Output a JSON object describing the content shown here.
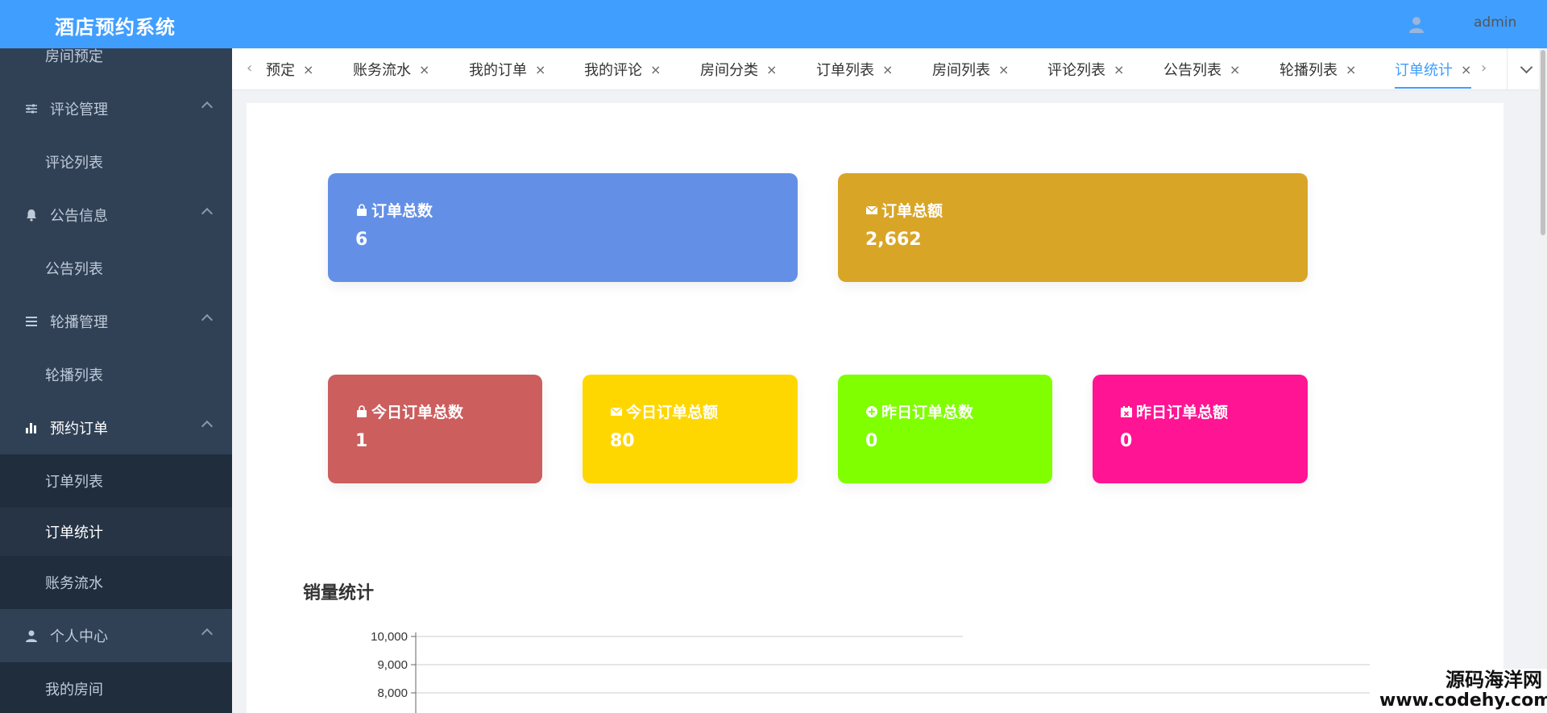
{
  "header": {
    "app_title": "酒店预约系统",
    "user_name": "admin",
    "user_icon": "user-icon"
  },
  "sidebar": {
    "items": [
      {
        "label": "房间预定",
        "type": "sub"
      },
      {
        "label": "评论管理",
        "type": "group",
        "icon": "sliders-icon"
      },
      {
        "label": "评论列表",
        "type": "sub"
      },
      {
        "label": "公告信息",
        "type": "group",
        "icon": "bell-icon"
      },
      {
        "label": "公告列表",
        "type": "sub"
      },
      {
        "label": "轮播管理",
        "type": "group",
        "icon": "list-icon"
      },
      {
        "label": "轮播列表",
        "type": "sub"
      },
      {
        "label": "预约订单",
        "type": "group",
        "icon": "bar-chart-icon"
      },
      {
        "label": "订单列表",
        "type": "sub"
      },
      {
        "label": "订单统计",
        "type": "sub",
        "active": true
      },
      {
        "label": "账务流水",
        "type": "sub"
      },
      {
        "label": "个人中心",
        "type": "group",
        "icon": "person-icon"
      },
      {
        "label": "我的房间",
        "type": "sub"
      }
    ]
  },
  "tabs": {
    "items": [
      {
        "label": "预定"
      },
      {
        "label": "账务流水"
      },
      {
        "label": "我的订单"
      },
      {
        "label": "我的评论"
      },
      {
        "label": "房间分类"
      },
      {
        "label": "订单列表"
      },
      {
        "label": "房间列表"
      },
      {
        "label": "评论列表"
      },
      {
        "label": "公告列表"
      },
      {
        "label": "轮播列表"
      },
      {
        "label": "订单统计",
        "active": true
      }
    ],
    "close_glyph": "×",
    "prev_glyph": "‹",
    "next_glyph": "›"
  },
  "stats": {
    "total_orders": {
      "label": "订单总数",
      "value": "6",
      "color": "#6390e6",
      "icon": "bag-icon"
    },
    "total_amount": {
      "label": "订单总额",
      "value": "2,662",
      "color": "#d9a526",
      "icon": "envelope-icon"
    },
    "today_orders": {
      "label": "今日订单总数",
      "value": "1",
      "color": "#cc5e5e",
      "icon": "bag-icon"
    },
    "today_amount": {
      "label": "今日订单总额",
      "value": "80",
      "color": "#ffd700",
      "icon": "envelope-icon"
    },
    "yesterday_orders": {
      "label": "昨日订单总数",
      "value": "0",
      "color": "#7fff00",
      "icon": "plus-circle-icon"
    },
    "yesterday_amount": {
      "label": "昨日订单总额",
      "value": "0",
      "color": "#ff1493",
      "icon": "calendar-x-icon"
    }
  },
  "sales_section": {
    "title": "销量统计"
  },
  "chart_data": {
    "type": "bar",
    "title": "",
    "xlabel": "",
    "ylabel": "",
    "y_ticks": [
      "10,000",
      "9,000",
      "8,000"
    ],
    "y_tick_values": [
      10000,
      9000,
      8000
    ],
    "grid": true,
    "categories": [],
    "values": []
  },
  "watermark": {
    "line1": "源码海洋网",
    "line2": "www.codehy.com"
  }
}
